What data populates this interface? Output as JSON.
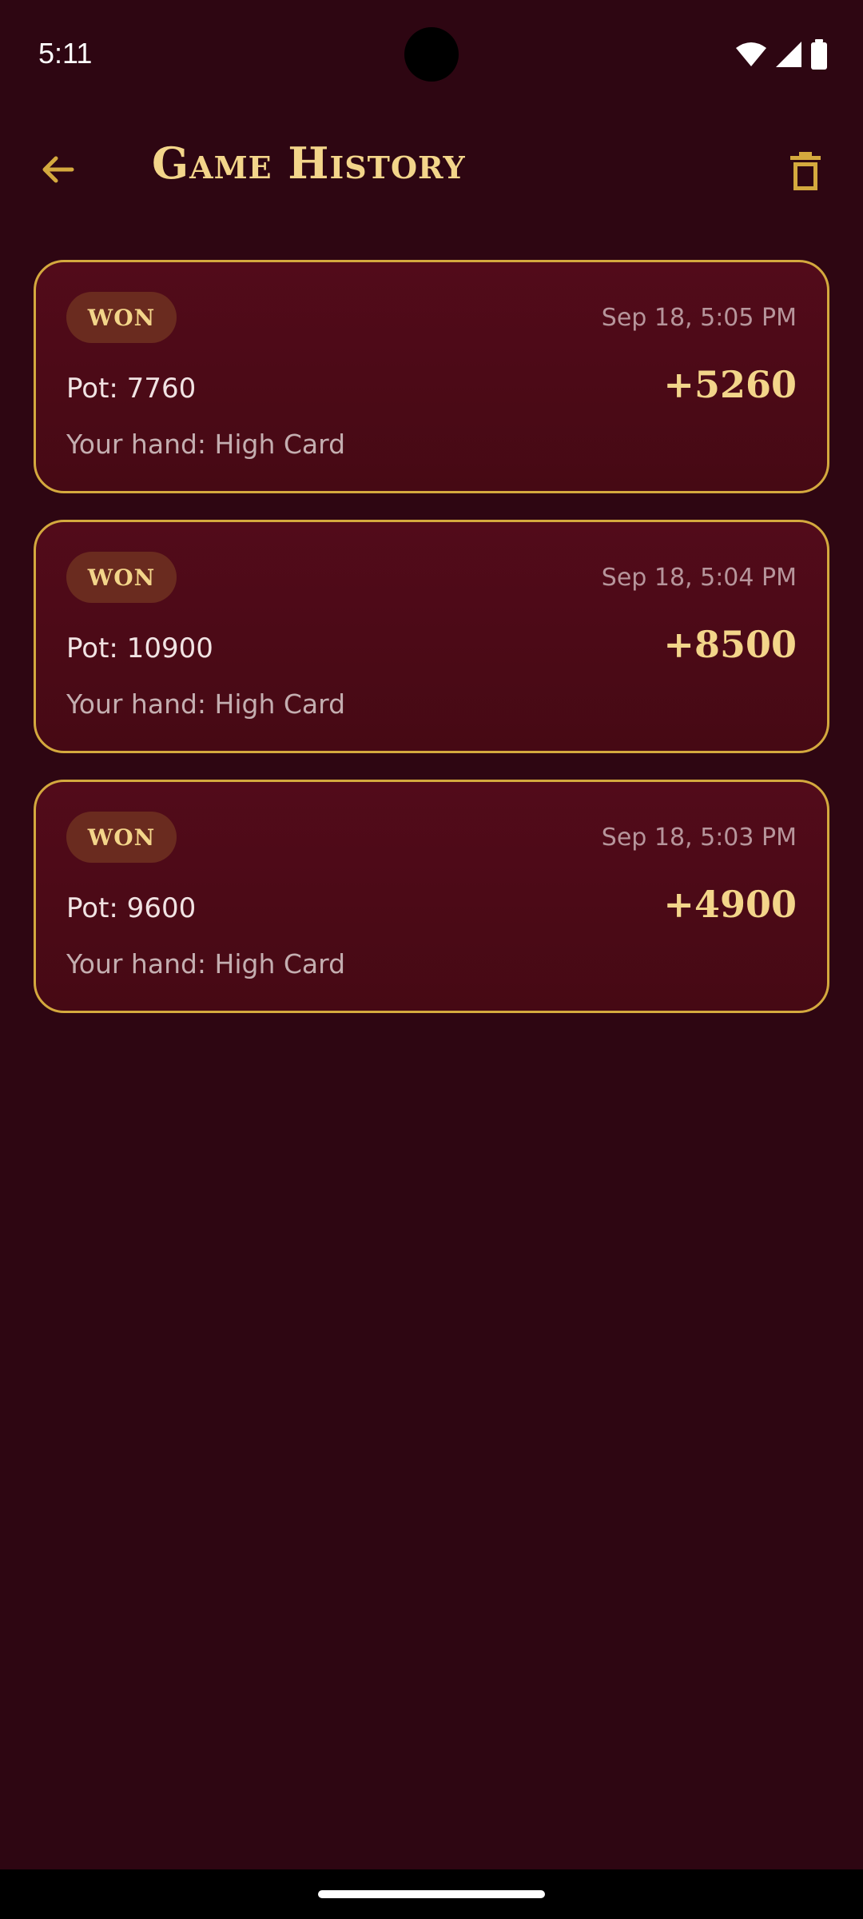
{
  "status_bar": {
    "time": "5:11",
    "icons": [
      "wifi-icon",
      "signal-icon",
      "battery-icon"
    ]
  },
  "header": {
    "title": "Game History",
    "back_icon": "arrow-left-icon",
    "delete_icon": "trash-icon"
  },
  "colors": {
    "background": "#2e0612",
    "card": "#4e0a18",
    "accent_gold": "#d4a93e",
    "title_gold": "#f3d58a",
    "badge_bg": "#6a2b1f"
  },
  "games": [
    {
      "result": "WON",
      "time": "Sep 18, 5:05 PM",
      "pot": "Pot: 7760",
      "winnings": "+5260",
      "hand": "Your hand: High Card"
    },
    {
      "result": "WON",
      "time": "Sep 18, 5:04 PM",
      "pot": "Pot: 10900",
      "winnings": "+8500",
      "hand": "Your hand: High Card"
    },
    {
      "result": "WON",
      "time": "Sep 18, 5:03 PM",
      "pot": "Pot: 9600",
      "winnings": "+4900",
      "hand": "Your hand: High Card"
    }
  ]
}
